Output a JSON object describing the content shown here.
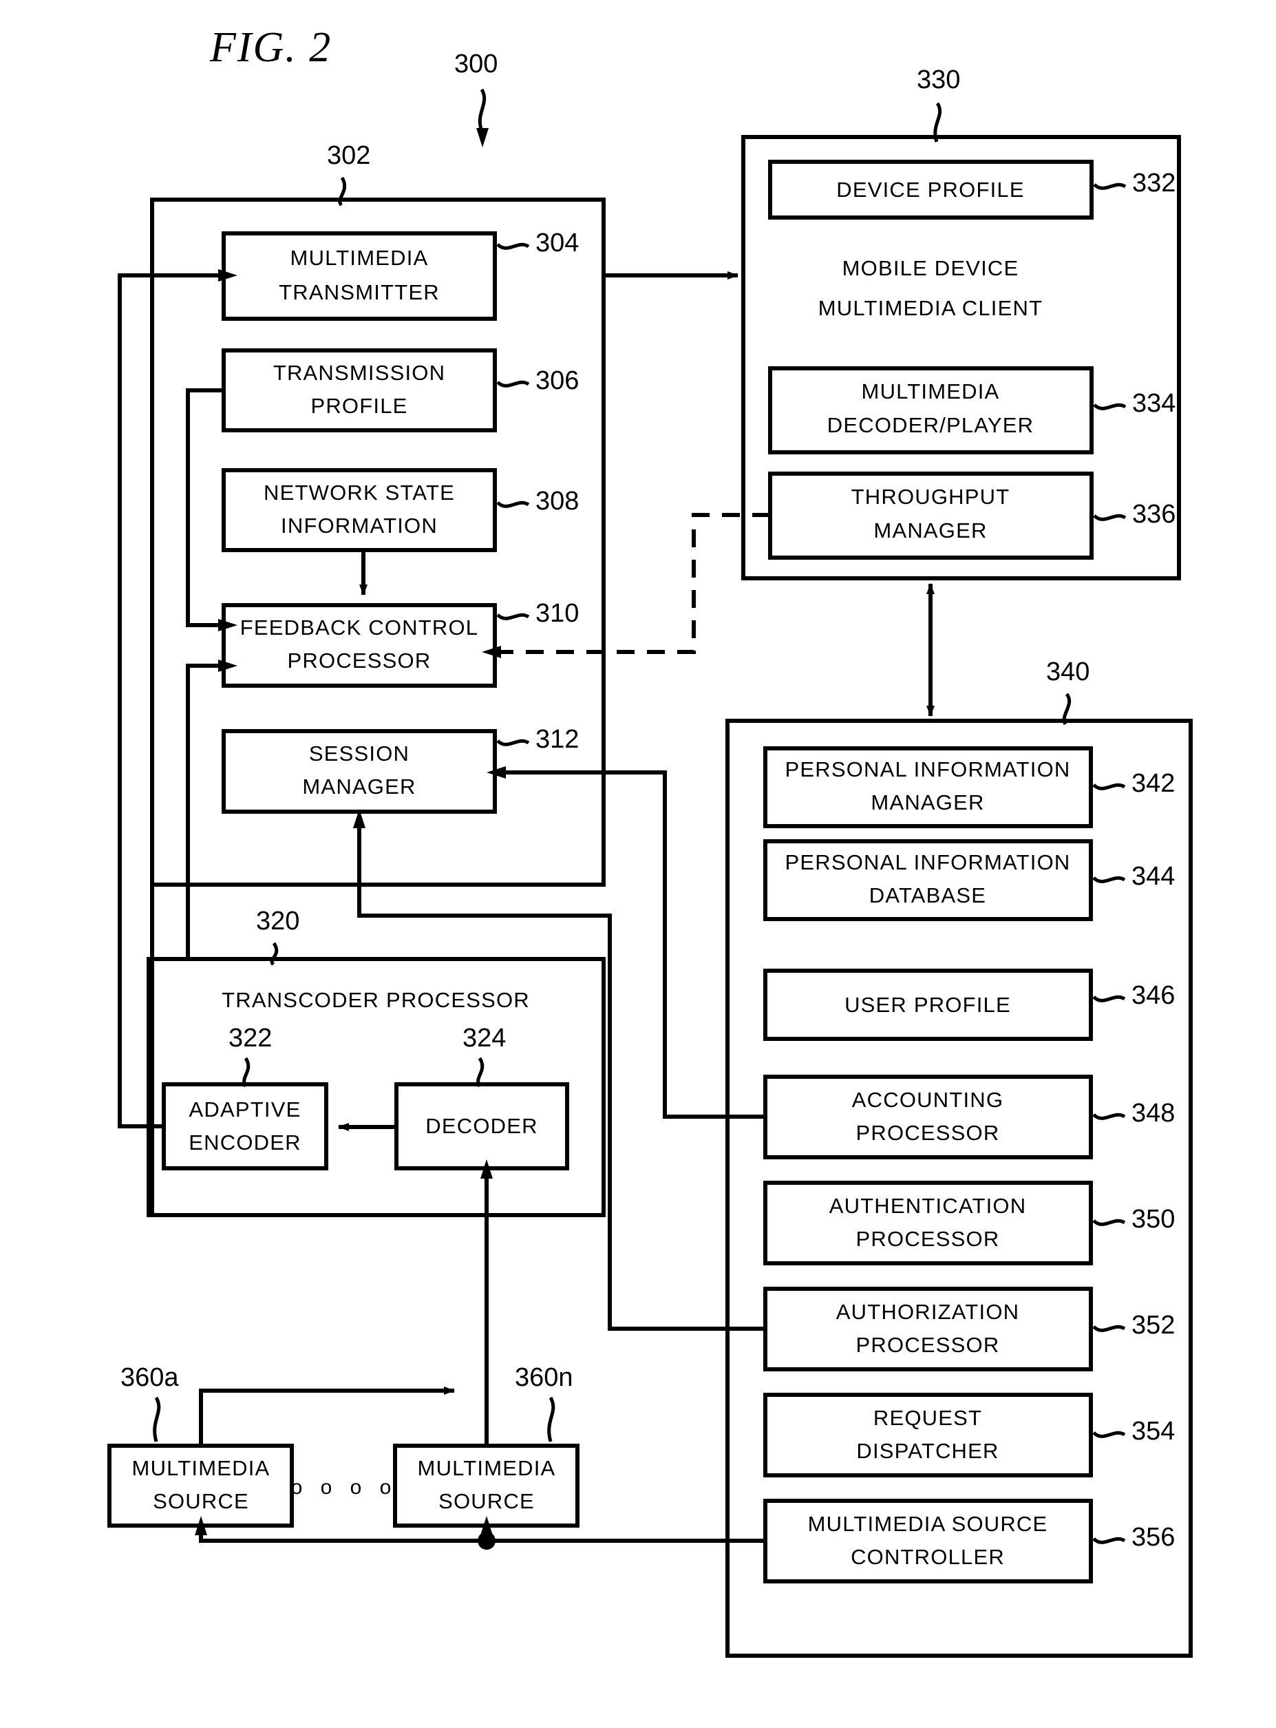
{
  "figure": {
    "title": "FIG. 2",
    "system_ref": "300"
  },
  "server_block": {
    "ref": "302",
    "items": [
      {
        "ref": "304",
        "lines": [
          "MULTIMEDIA",
          "TRANSMITTER"
        ]
      },
      {
        "ref": "306",
        "lines": [
          "TRANSMISSION",
          "PROFILE"
        ]
      },
      {
        "ref": "308",
        "lines": [
          "NETWORK STATE",
          "INFORMATION"
        ]
      },
      {
        "ref": "310",
        "lines": [
          "FEEDBACK CONTROL",
          "PROCESSOR"
        ]
      },
      {
        "ref": "312",
        "lines": [
          "SESSION",
          "MANAGER"
        ]
      }
    ]
  },
  "transcoder_block": {
    "ref": "320",
    "title": "TRANSCODER PROCESSOR",
    "items": [
      {
        "ref": "322",
        "lines": [
          "ADAPTIVE",
          "ENCODER"
        ]
      },
      {
        "ref": "324",
        "lines": [
          "DECODER"
        ]
      }
    ]
  },
  "client_block": {
    "ref": "330",
    "title_lines": [
      "MOBILE DEVICE",
      "MULTIMEDIA CLIENT"
    ],
    "items": [
      {
        "ref": "332",
        "lines": [
          "DEVICE PROFILE"
        ]
      },
      {
        "ref": "334",
        "lines": [
          "MULTIMEDIA",
          "DECODER/PLAYER"
        ]
      },
      {
        "ref": "336",
        "lines": [
          "THROUGHPUT",
          "MANAGER"
        ]
      }
    ]
  },
  "services_block": {
    "ref": "340",
    "items": [
      {
        "ref": "342",
        "lines": [
          "PERSONAL INFORMATION",
          "MANAGER"
        ]
      },
      {
        "ref": "344",
        "lines": [
          "PERSONAL INFORMATION",
          "DATABASE"
        ]
      },
      {
        "ref": "346",
        "lines": [
          "USER PROFILE"
        ]
      },
      {
        "ref": "348",
        "lines": [
          "ACCOUNTING",
          "PROCESSOR"
        ]
      },
      {
        "ref": "350",
        "lines": [
          "AUTHENTICATION",
          "PROCESSOR"
        ]
      },
      {
        "ref": "352",
        "lines": [
          "AUTHORIZATION",
          "PROCESSOR"
        ]
      },
      {
        "ref": "354",
        "lines": [
          "REQUEST",
          "DISPATCHER"
        ]
      },
      {
        "ref": "356",
        "lines": [
          "MULTIMEDIA SOURCE",
          "CONTROLLER"
        ]
      }
    ]
  },
  "sources_block": {
    "ellipsis": "o o o o",
    "items": [
      {
        "ref": "360a",
        "lines": [
          "MULTIMEDIA",
          "SOURCE"
        ]
      },
      {
        "ref": "360n",
        "lines": [
          "MULTIMEDIA",
          "SOURCE"
        ]
      }
    ]
  }
}
